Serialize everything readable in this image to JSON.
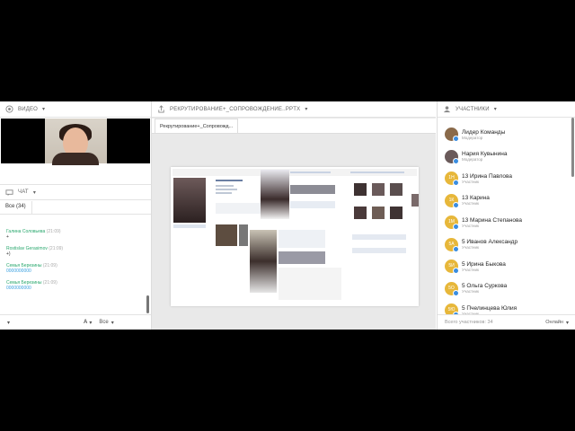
{
  "left": {
    "video_title": "ВИДЕО",
    "chat_title": "ЧАТ",
    "chat_tab": "Все (34)",
    "messages": [
      {
        "name": "Галина Соловьева",
        "time": "(21:09)",
        "text": "+",
        "color": "#2aa86e"
      },
      {
        "name": "Rostislav Gerasimov",
        "time": "(21:09)",
        "text": "+)",
        "color": "#2aa86e"
      },
      {
        "name": "Семья Березины",
        "time": "(21:09)",
        "text": "0000000000",
        "color": "#2aa86e"
      },
      {
        "name": "Семья Березины",
        "time": "(21:09)",
        "text": "0000000000",
        "color": "#2aa86e"
      }
    ],
    "footer_filter": "Все"
  },
  "middle": {
    "title": "РЕКРУТИРОВАНИЕ+_СОПРОВОЖДЕНИЕ..PPTX",
    "doc_tab": "Рекрутирование+_Сопровожд..."
  },
  "right": {
    "title": "УЧАСТНИКИ",
    "participants": [
      {
        "initials": "",
        "name": "Лидер Команды",
        "role": "Модератор",
        "avatar_color": "#8a6a4a"
      },
      {
        "initials": "",
        "name": "Нария Кувынина",
        "role": "Модератор",
        "avatar_color": "#6a5a5a"
      },
      {
        "initials": "1Н",
        "name": "13 Ирина Павлова",
        "role": "Участник",
        "avatar_color": "#e7b73a"
      },
      {
        "initials": "1К",
        "name": "13 Карина",
        "role": "Участник",
        "avatar_color": "#e7b73a"
      },
      {
        "initials": "1М",
        "name": "13 Марина Степанова",
        "role": "Участник",
        "avatar_color": "#e7b73a"
      },
      {
        "initials": "5А",
        "name": "5 Иванов Александр",
        "role": "Участник",
        "avatar_color": "#e7b73a"
      },
      {
        "initials": "5И",
        "name": "5 Ирина Быкова",
        "role": "Участник",
        "avatar_color": "#e7b73a"
      },
      {
        "initials": "5О",
        "name": "5 Ольга Суркова",
        "role": "Участник",
        "avatar_color": "#e7b73a"
      },
      {
        "initials": "5Ю",
        "name": "5 Пчелинцева Юлия",
        "role": "Участник",
        "avatar_color": "#e7b73a"
      }
    ],
    "total": "Всего участников: 34",
    "status": "Онлайн"
  }
}
